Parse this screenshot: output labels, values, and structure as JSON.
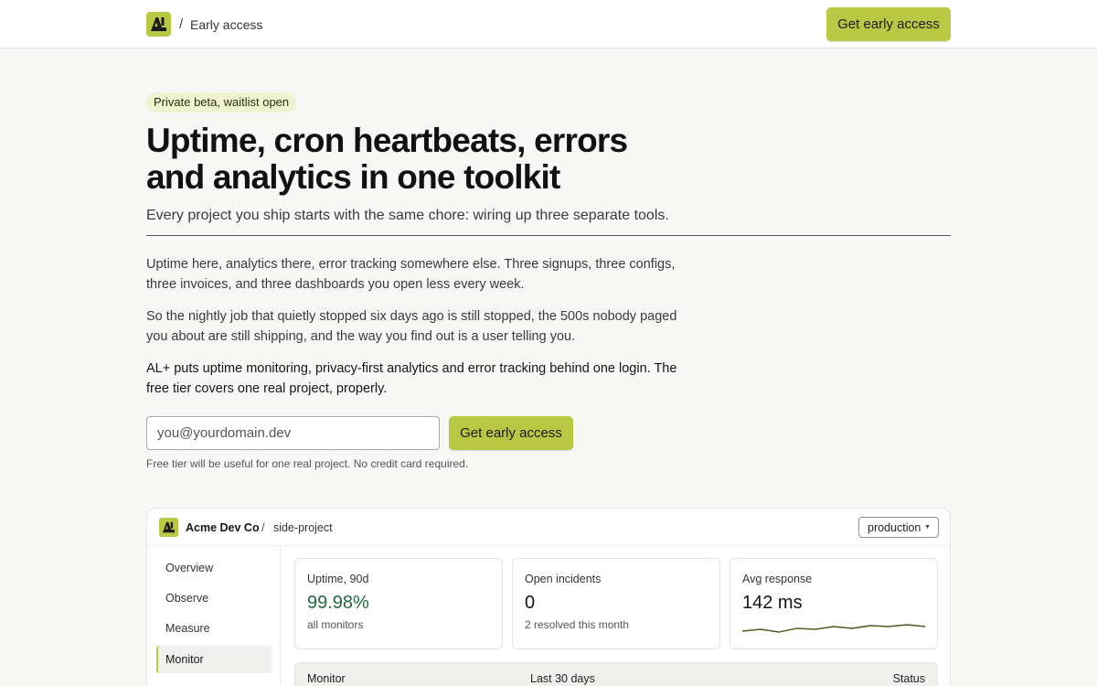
{
  "topbar": {
    "logo_alt": "AL+ logo",
    "breadcrumb_separator": "/",
    "breadcrumb": "Early access",
    "cta_label": "Get early access"
  },
  "hero": {
    "badge": "Private beta, waitlist open",
    "title_line1": "Uptime, cron heartbeats, errors",
    "title_line2": "and analytics in one toolkit",
    "subtitle": "Every project you ship starts with the same chore: wiring up three separate tools.",
    "paragraphs": [
      "Uptime here, analytics there, error tracking somewhere else. Three signups, three configs, three invoices, and three dashboards you open less every week.",
      "So the nightly job that quietly stopped six days ago is still stopped, the 500s nobody paged you about are still shipping, and the way you find out is a user telling you.",
      "AL+ puts uptime monitoring, privacy-first analytics and error tracking behind one login. The free tier covers one real project, properly."
    ]
  },
  "signup": {
    "email_placeholder": "you@yourdomain.dev",
    "email_value": "",
    "cta_label": "Get early access",
    "fineprint": "Free tier will be useful for one real project. No credit card required."
  },
  "app_preview": {
    "org": "Acme Dev Co",
    "separator": "/",
    "project": "side-project",
    "environment": "production",
    "nav": [
      {
        "label": "Overview",
        "active": false
      },
      {
        "label": "Observe",
        "active": false
      },
      {
        "label": "Measure",
        "active": false
      },
      {
        "label": "Monitor",
        "active": true
      }
    ],
    "stats": [
      {
        "label": "Uptime, 90d",
        "value": "99.98%",
        "note": "all monitors"
      },
      {
        "label": "Open incidents",
        "value": "0",
        "note": "2 resolved this month"
      },
      {
        "label": "Avg response",
        "value": "142 ms",
        "note": ""
      }
    ],
    "table_headers": [
      "Monitor",
      "Last 30 days",
      "Status"
    ]
  },
  "colors": {
    "accent": "#b8c842",
    "uptime_green": "#1f6b3a",
    "sparkline": "#4b5a1c"
  },
  "icons": {
    "brand": "al-logo-icon",
    "env_dropdown": "caret-down-icon"
  }
}
